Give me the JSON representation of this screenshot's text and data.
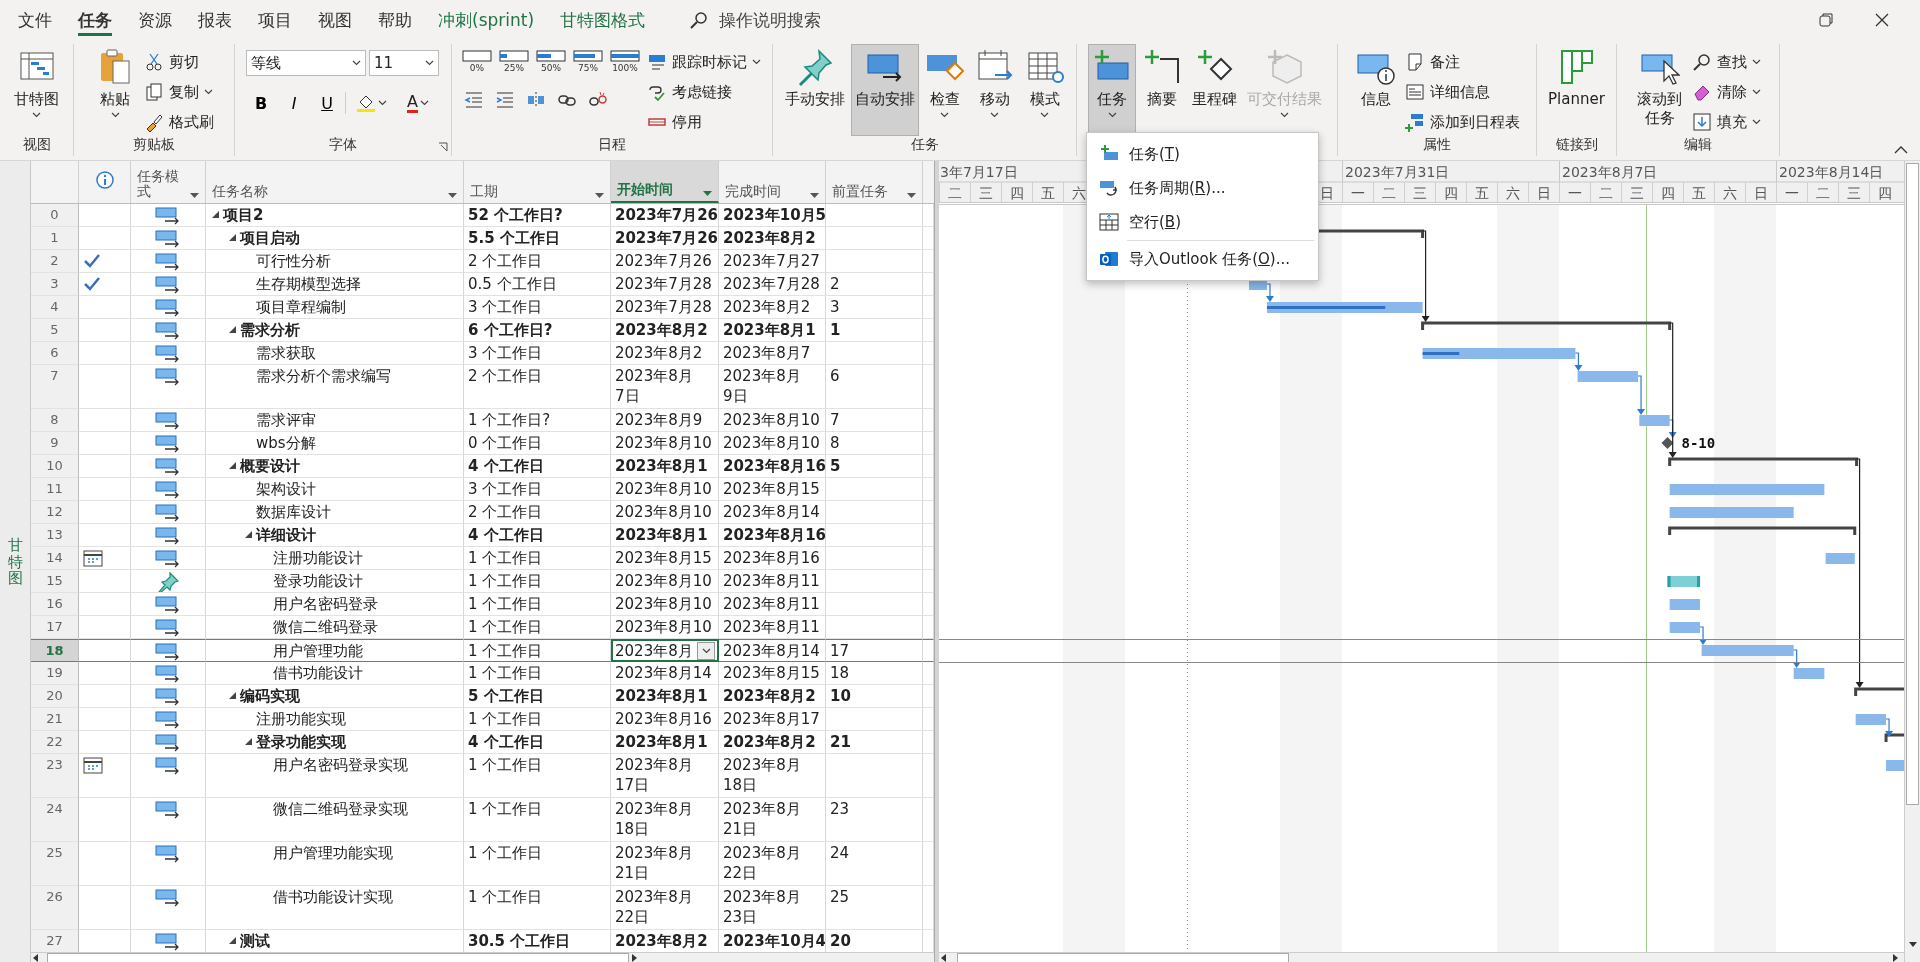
{
  "tabs": [
    {
      "label": "文件",
      "selected": false,
      "kind": "standard"
    },
    {
      "label": "任务",
      "selected": true,
      "kind": "standard"
    },
    {
      "label": "资源",
      "selected": false,
      "kind": "standard"
    },
    {
      "label": "报表",
      "selected": false,
      "kind": "standard"
    },
    {
      "label": "项目",
      "selected": false,
      "kind": "standard"
    },
    {
      "label": "视图",
      "selected": false,
      "kind": "standard"
    },
    {
      "label": "帮助",
      "selected": false,
      "kind": "standard"
    },
    {
      "label": "冲刺(sprint)",
      "selected": false,
      "kind": "contextual"
    },
    {
      "label": "甘特图格式",
      "selected": false,
      "kind": "contextual"
    }
  ],
  "search": {
    "placeholder": "操作说明搜索"
  },
  "ribbon": {
    "groups": [
      {
        "label": "视图",
        "items": [
          {
            "kind": "large",
            "label": "甘特图",
            "caret": true,
            "pressed": false,
            "disabled": false
          }
        ]
      },
      {
        "label": "剪贴板",
        "items": [
          {
            "kind": "large",
            "label": "粘贴",
            "caret": true,
            "pressed": false,
            "disabled": false
          },
          {
            "kind": "stack",
            "items": [
              {
                "label": "剪切",
                "caret": false
              },
              {
                "label": "复制",
                "caret": true
              },
              {
                "label": "格式刷",
                "caret": false
              }
            ]
          }
        ]
      },
      {
        "label": "字体",
        "launcher": true,
        "items": [
          {
            "kind": "font",
            "font": "等线",
            "size": "11",
            "styles": [
              "B",
              "I",
              "U"
            ],
            "font_color": "A"
          }
        ]
      },
      {
        "label": "日程",
        "items": [
          {
            "kind": "schedule",
            "percents": [
              "0%",
              "25%",
              "50%",
              "75%",
              "100%"
            ]
          },
          {
            "kind": "stack",
            "items": [
              {
                "label": "跟踪时标记",
                "caret": true
              },
              {
                "label": "考虑链接",
                "caret": false
              },
              {
                "label": "停用",
                "caret": false
              }
            ]
          }
        ]
      },
      {
        "label": "任务",
        "items": [
          {
            "kind": "large",
            "label": "手动安排",
            "caret": false,
            "pressed": false,
            "disabled": false
          },
          {
            "kind": "large",
            "label": "自动安排",
            "caret": false,
            "pressed": true,
            "disabled": false
          },
          {
            "kind": "large",
            "label": "检查",
            "caret": true,
            "pressed": false,
            "disabled": false
          },
          {
            "kind": "large",
            "label": "移动",
            "caret": true,
            "pressed": false,
            "disabled": false
          },
          {
            "kind": "large",
            "label": "模式",
            "caret": true,
            "pressed": false,
            "disabled": false
          }
        ]
      },
      {
        "items": [
          {
            "kind": "large",
            "label": "任务",
            "caret": true,
            "pressed": true,
            "disabled": false
          },
          {
            "kind": "large",
            "label": "摘要",
            "caret": false,
            "pressed": false,
            "disabled": false
          },
          {
            "kind": "large",
            "label": "里程碑",
            "caret": false,
            "pressed": false,
            "disabled": false
          },
          {
            "kind": "large",
            "label": "可交付结果",
            "caret": true,
            "pressed": false,
            "disabled": true
          }
        ]
      },
      {
        "label": "属性",
        "items": [
          {
            "kind": "large",
            "label": "信息",
            "caret": false,
            "pressed": false,
            "disabled": false
          },
          {
            "kind": "stack",
            "items": [
              {
                "label": "备注",
                "caret": false
              },
              {
                "label": "详细信息",
                "caret": false
              },
              {
                "label": "添加到日程表",
                "caret": false
              }
            ]
          }
        ]
      },
      {
        "label": "链接到",
        "items": [
          {
            "kind": "large",
            "label": "Planner",
            "caret": false,
            "pressed": false,
            "disabled": false
          }
        ]
      },
      {
        "label": "编辑",
        "items": [
          {
            "kind": "large",
            "label": "滚动到任务",
            "caret": false,
            "pressed": false,
            "disabled": false
          },
          {
            "kind": "stack",
            "items": [
              {
                "label": "查找",
                "caret": true
              },
              {
                "label": "清除",
                "caret": true
              },
              {
                "label": "填充",
                "caret": true
              }
            ]
          }
        ]
      }
    ]
  },
  "task_menu": {
    "items": [
      {
        "before": "任务(",
        "key": "T",
        "after": ")",
        "separator": false
      },
      {
        "before": "任务周期(",
        "key": "R",
        "after": ")...",
        "separator": false
      },
      {
        "before": "空行(",
        "key": "B",
        "after": ")",
        "separator": false
      },
      {
        "before": "导入Outlook 任务(",
        "key": "O",
        "after": ")...",
        "separator": true
      }
    ]
  },
  "view_bar": {
    "label": "甘特图"
  },
  "table": {
    "columns": [
      {
        "kind": "info",
        "selected": false
      },
      {
        "kind": "mode",
        "label": "任务模式",
        "selected": false
      },
      {
        "kind": "name",
        "label": "任务名称",
        "selected": false
      },
      {
        "kind": "duration",
        "label": "工期",
        "selected": false
      },
      {
        "kind": "start",
        "label": "开始时间",
        "selected": true
      },
      {
        "kind": "finish",
        "label": "完成时间",
        "selected": false
      },
      {
        "kind": "predecessors",
        "label": "前置任务",
        "selected": false
      }
    ],
    "rows": [
      {
        "id": "0",
        "mode": {
          "kind": "auto"
        },
        "name": "项目2",
        "duration": "52 个工作日?",
        "start": "2023年7月26",
        "finish": "2023年10月5",
        "summary": true,
        "expanded": true,
        "selected": false,
        "children": [
          {
            "id": "1",
            "mode": {
              "kind": "auto"
            },
            "name": "项目启动",
            "duration": "5.5 个工作日",
            "start": "2023年7月26",
            "finish": "2023年8月2",
            "summary": true,
            "expanded": true,
            "selected": false,
            "children": [
              {
                "id": "2",
                "info": {
                  "kind": "complete"
                },
                "mode": {
                  "kind": "auto"
                },
                "name": "可行性分析",
                "duration": "2 个工作日",
                "start": "2023年7月26",
                "finish": "2023年7月27",
                "summary": false,
                "selected": false
              },
              {
                "id": "3",
                "info": {
                  "kind": "complete"
                },
                "mode": {
                  "kind": "auto"
                },
                "name": "生存期模型选择",
                "duration": "0.5 个工作日",
                "start": "2023年7月28",
                "finish": "2023年7月28",
                "predecessors": "2",
                "summary": false,
                "selected": false
              },
              {
                "id": "4",
                "mode": {
                  "kind": "auto"
                },
                "name": "项目章程编制",
                "duration": "3 个工作日",
                "start": "2023年7月28",
                "finish": "2023年8月2",
                "predecessors": "3",
                "summary": false,
                "selected": false
              }
            ]
          },
          {
            "id": "5",
            "mode": {
              "kind": "auto"
            },
            "name": "需求分析",
            "duration": "6 个工作日?",
            "start": "2023年8月2",
            "finish": "2023年8月1",
            "predecessors": "1",
            "summary": true,
            "expanded": true,
            "selected": false,
            "children": [
              {
                "id": "6",
                "mode": {
                  "kind": "auto"
                },
                "name": "需求获取",
                "duration": "3 个工作日",
                "start": "2023年8月2",
                "finish": "2023年8月7",
                "summary": false,
                "selected": false
              },
              {
                "id": "7",
                "mode": {
                  "kind": "auto"
                },
                "name": "需求分析个需求编写",
                "duration": "2 个工作日",
                "start": "2023年8月\n7日",
                "finish": "2023年8月\n9日",
                "predecessors": "6",
                "summary": false,
                "selected": false
              },
              {
                "id": "8",
                "mode": {
                  "kind": "auto"
                },
                "name": "需求评审",
                "duration": "1 个工作日?",
                "start": "2023年8月9",
                "finish": "2023年8月10",
                "predecessors": "7",
                "summary": false,
                "selected": false
              },
              {
                "id": "9",
                "mode": {
                  "kind": "auto"
                },
                "name": "wbs分解",
                "duration": "0 个工作日",
                "start": "2023年8月10",
                "finish": "2023年8月10",
                "predecessors": "8",
                "summary": false,
                "milestone_label": "8-10",
                "selected": false
              }
            ]
          },
          {
            "id": "10",
            "mode": {
              "kind": "auto"
            },
            "name": "概要设计",
            "duration": "4 个工作日",
            "start": "2023年8月1",
            "finish": "2023年8月16",
            "predecessors": "5",
            "summary": true,
            "expanded": true,
            "selected": false,
            "children": [
              {
                "id": "11",
                "mode": {
                  "kind": "auto"
                },
                "name": "架构设计",
                "duration": "3 个工作日",
                "start": "2023年8月10",
                "finish": "2023年8月15",
                "summary": false,
                "selected": false
              },
              {
                "id": "12",
                "mode": {
                  "kind": "auto"
                },
                "name": "数据库设计",
                "duration": "2 个工作日",
                "start": "2023年8月10",
                "finish": "2023年8月14",
                "summary": false,
                "selected": false
              },
              {
                "id": "13",
                "mode": {
                  "kind": "auto"
                },
                "name": "详细设计",
                "duration": "4 个工作日",
                "start": "2023年8月1",
                "finish": "2023年8月16",
                "summary": true,
                "expanded": true,
                "selected": false,
                "children": [
                  {
                    "id": "14",
                    "info": {
                      "kind": "constraint"
                    },
                    "mode": {
                      "kind": "auto"
                    },
                    "name": "注册功能设计",
                    "duration": "1 个工作日",
                    "start": "2023年8月15",
                    "finish": "2023年8月16",
                    "summary": false,
                    "selected": false
                  },
                  {
                    "id": "15",
                    "mode": {
                      "kind": "manual"
                    },
                    "name": "登录功能设计",
                    "duration": "1 个工作日",
                    "start": "2023年8月10",
                    "finish": "2023年8月11",
                    "summary": false,
                    "selected": false
                  },
                  {
                    "id": "16",
                    "mode": {
                      "kind": "auto"
                    },
                    "name": "用户名密码登录",
                    "duration": "1 个工作日",
                    "start": "2023年8月10",
                    "finish": "2023年8月11",
                    "summary": false,
                    "selected": false
                  },
                  {
                    "id": "17",
                    "mode": {
                      "kind": "auto"
                    },
                    "name": "微信二维码登录",
                    "duration": "1 个工作日",
                    "start": "2023年8月10",
                    "finish": "2023年8月11",
                    "summary": false,
                    "selected": false
                  },
                  {
                    "id": "18",
                    "mode": {
                      "kind": "auto"
                    },
                    "name": "用户管理功能",
                    "duration": "1 个工作日",
                    "start": "2023年8月",
                    "finish": "2023年8月14",
                    "predecessors": "17",
                    "summary": false,
                    "selected": true
                  },
                  {
                    "id": "19",
                    "mode": {
                      "kind": "auto"
                    },
                    "name": "借书功能设计",
                    "duration": "1 个工作日",
                    "start": "2023年8月14",
                    "finish": "2023年8月15",
                    "predecessors": "18",
                    "summary": false,
                    "selected": false
                  }
                ]
              }
            ]
          },
          {
            "id": "20",
            "mode": {
              "kind": "auto"
            },
            "name": "编码实现",
            "duration": "5 个工作日",
            "start": "2023年8月1",
            "finish": "2023年8月2",
            "predecessors": "10",
            "summary": true,
            "expanded": true,
            "selected": false,
            "children": [
              {
                "id": "21",
                "mode": {
                  "kind": "auto"
                },
                "name": "注册功能实现",
                "duration": "1 个工作日",
                "start": "2023年8月16",
                "finish": "2023年8月17",
                "summary": false,
                "selected": false
              },
              {
                "id": "22",
                "mode": {
                  "kind": "auto"
                },
                "name": "登录功能实现",
                "duration": "4 个工作日",
                "start": "2023年8月1",
                "finish": "2023年8月2",
                "predecessors": "21",
                "summary": true,
                "expanded": true,
                "selected": false,
                "children": [
                  {
                    "id": "23",
                    "info": {
                      "kind": "constraint"
                    },
                    "mode": {
                      "kind": "auto"
                    },
                    "name": "用户名密码登录实现",
                    "duration": "1 个工作日",
                    "start": "2023年8月\n17日",
                    "finish": "2023年8月\n18日",
                    "summary": false,
                    "selected": false
                  },
                  {
                    "id": "24",
                    "mode": {
                      "kind": "auto"
                    },
                    "name": "微信二维码登录实现",
                    "duration": "1 个工作日",
                    "start": "2023年8月\n18日",
                    "finish": "2023年8月\n21日",
                    "predecessors": "23",
                    "summary": false,
                    "selected": false
                  },
                  {
                    "id": "25",
                    "mode": {
                      "kind": "auto"
                    },
                    "name": "用户管理功能实现",
                    "duration": "1 个工作日",
                    "start": "2023年8月\n21日",
                    "finish": "2023年8月\n22日",
                    "predecessors": "24",
                    "summary": false,
                    "selected": false
                  },
                  {
                    "id": "26",
                    "mode": {
                      "kind": "auto"
                    },
                    "name": "借书功能设计实现",
                    "duration": "1 个工作日",
                    "start": "2023年8月\n22日",
                    "finish": "2023年8月\n23日",
                    "predecessors": "25",
                    "summary": false,
                    "selected": false
                  }
                ]
              }
            ]
          },
          {
            "id": "27",
            "mode": {
              "kind": "auto"
            },
            "name": "测试",
            "duration": "30.5 个工作日",
            "start": "2023年8月2",
            "finish": "2023年10月4",
            "predecessors": "20",
            "summary": true,
            "expanded": true,
            "selected": false
          }
        ]
      }
    ]
  },
  "gantt": {
    "weeks": [
      "3年7月17日",
      "2023年7月31日",
      "2023年8月7日",
      "2023年8月14日"
    ],
    "days_before_menu": [
      "二",
      "三",
      "四",
      "五",
      "六"
    ],
    "days_after_menu": [
      "日",
      "一",
      "二",
      "三",
      "四",
      "五",
      "六",
      "日",
      "一",
      "二",
      "三",
      "四",
      "五",
      "六",
      "日",
      "一",
      "二",
      "三",
      "四"
    ]
  }
}
